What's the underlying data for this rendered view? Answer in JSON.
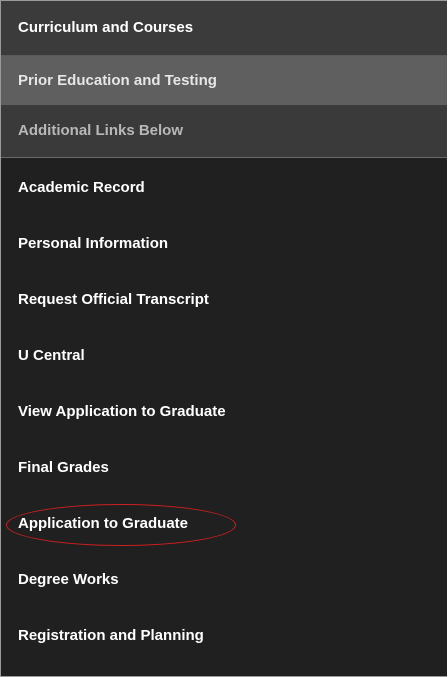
{
  "sections": {
    "curriculum_label": "Curriculum and Courses",
    "prior_label": "Prior Education and Testing",
    "additional_label": "Additional Links Below"
  },
  "links": [
    {
      "label": "Academic Record"
    },
    {
      "label": "Personal Information"
    },
    {
      "label": "Request Official Transcript"
    },
    {
      "label": "U Central"
    },
    {
      "label": "View Application to Graduate"
    },
    {
      "label": "Final Grades"
    },
    {
      "label": "Application to Graduate",
      "highlighted": true
    },
    {
      "label": "Degree Works"
    },
    {
      "label": "Registration and Planning"
    }
  ],
  "colors": {
    "menu_background": "#202020",
    "highlight_annotation": "#cc1f1f"
  }
}
